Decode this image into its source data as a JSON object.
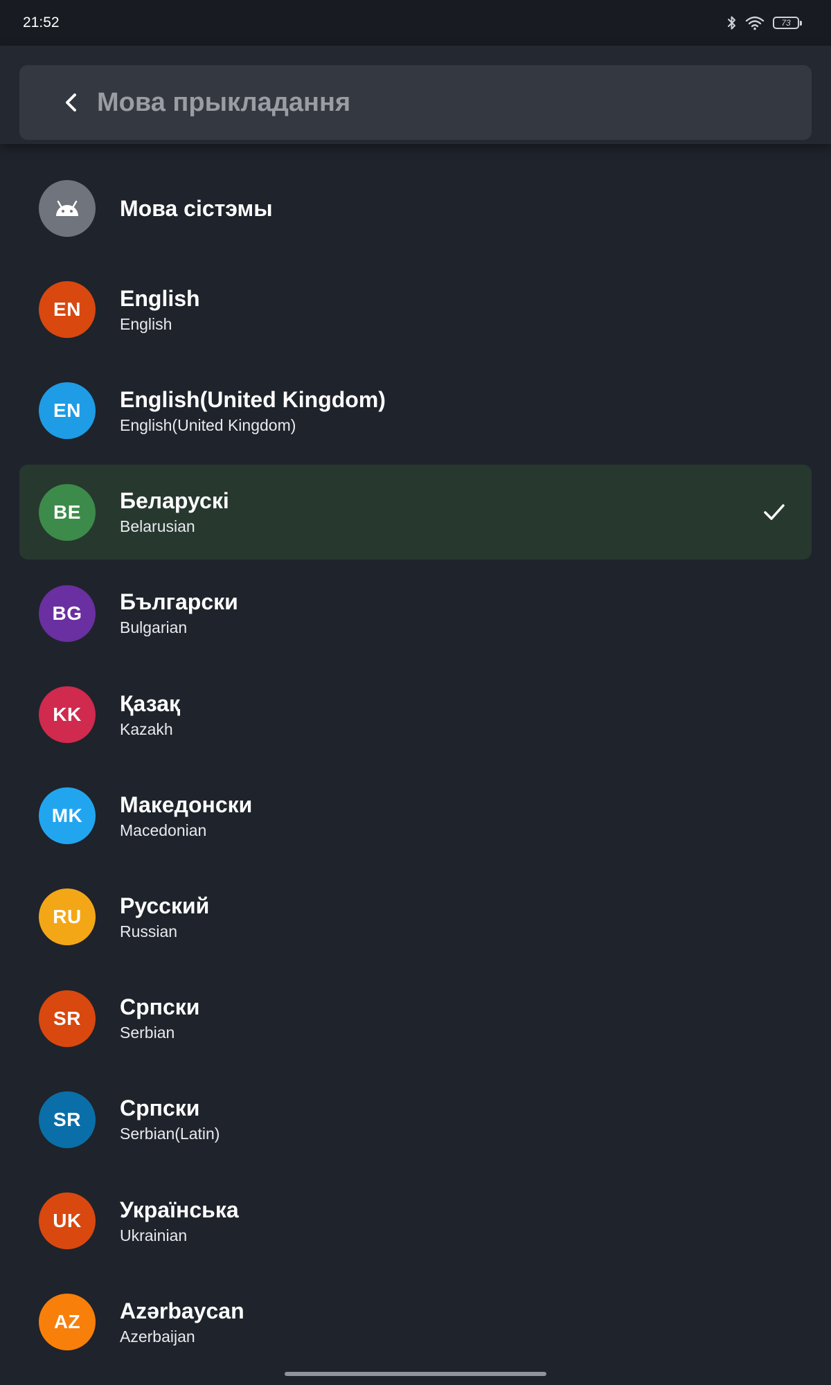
{
  "status_bar": {
    "time": "21:52",
    "battery_level": "73",
    "icons": [
      "bluetooth-icon",
      "wifi-icon",
      "battery-icon"
    ]
  },
  "toolbar": {
    "title": "Мова прыкладання",
    "back_icon": "back-arrow-icon"
  },
  "colors": {
    "background": "#1f232b",
    "selected_row": "#27382f",
    "check": "#ffffff"
  },
  "languages": [
    {
      "code": "",
      "icon": "android-icon",
      "name": "Мова сістэмы",
      "subtitle": "",
      "color": "#6f747d",
      "selected": false
    },
    {
      "code": "EN",
      "name": "English",
      "subtitle": "English",
      "color": "#d9480f",
      "selected": false
    },
    {
      "code": "EN",
      "name": "English(United Kingdom)",
      "subtitle": "English(United Kingdom)",
      "color": "#1e9ce6",
      "selected": false
    },
    {
      "code": "BE",
      "name": "Беларускі",
      "subtitle": "Belarusian",
      "color": "#3d8b4a",
      "selected": true
    },
    {
      "code": "BG",
      "name": "Български",
      "subtitle": "Bulgarian",
      "color": "#6a2fa0",
      "selected": false
    },
    {
      "code": "KK",
      "name": "Қазақ",
      "subtitle": "Kazakh",
      "color": "#d02a4e",
      "selected": false
    },
    {
      "code": "MK",
      "name": "Македонски",
      "subtitle": "Macedonian",
      "color": "#22a5ef",
      "selected": false
    },
    {
      "code": "RU",
      "name": "Русский",
      "subtitle": "Russian",
      "color": "#f4a716",
      "selected": false
    },
    {
      "code": "SR",
      "name": "Српски",
      "subtitle": "Serbian",
      "color": "#d9480f",
      "selected": false
    },
    {
      "code": "SR",
      "name": "Српски",
      "subtitle": "Serbian(Latin)",
      "color": "#0a6fa8",
      "selected": false
    },
    {
      "code": "UK",
      "name": "Українська",
      "subtitle": "Ukrainian",
      "color": "#d9480f",
      "selected": false
    },
    {
      "code": "AZ",
      "name": "Azərbaycan",
      "subtitle": "Azerbaijan",
      "color": "#f77f0a",
      "selected": false
    }
  ]
}
